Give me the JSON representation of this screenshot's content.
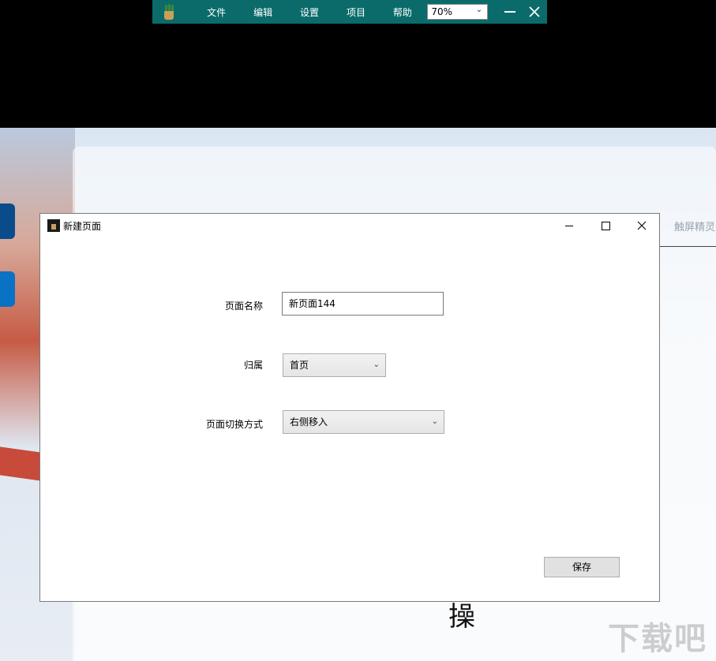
{
  "menubar": {
    "items": [
      "文件",
      "编辑",
      "设置",
      "项目",
      "帮助"
    ],
    "zoom": "70%"
  },
  "background": {
    "tab_text": "触屏精灵",
    "big_char": "操",
    "watermark": "下载吧"
  },
  "dialog": {
    "title": "新建页面",
    "fields": {
      "name_label": "页面名称",
      "name_value": "新页面144",
      "parent_label": "归属",
      "parent_value": "首页",
      "transition_label": "页面切换方式",
      "transition_value": "右侧移入"
    },
    "save_label": "保存"
  },
  "colors": {
    "menubar_bg": "#0b6b6b",
    "dialog_bg": "#ffffff"
  }
}
